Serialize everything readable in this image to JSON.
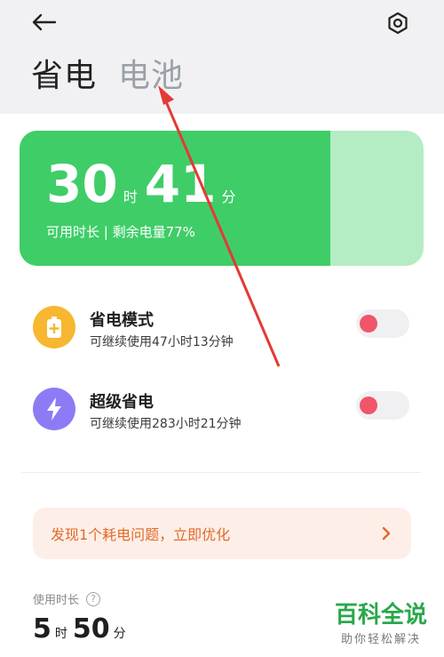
{
  "header": {
    "tabs": [
      {
        "label": "省电"
      },
      {
        "label": "电池"
      }
    ]
  },
  "battery": {
    "hours": "30",
    "hours_unit": "时",
    "minutes": "41",
    "minutes_unit": "分",
    "subtitle": "可用时长 | 剩余电量77%",
    "level_fraction": 0.77,
    "colors": {
      "fill": "#3fcd68",
      "remaining": "#b4ecc4"
    }
  },
  "modes": [
    {
      "title": "省电模式",
      "subtitle": "可继续使用47小时13分钟",
      "icon": "battery-plus-icon",
      "icon_color": "#f7b731",
      "enabled": false
    },
    {
      "title": "超级省电",
      "subtitle": "可继续使用283小时21分钟",
      "icon": "lightning-icon",
      "icon_color": "#8b7cf6",
      "enabled": false
    }
  ],
  "issue_banner": {
    "text": "发现1个耗电问题，立即优化"
  },
  "usage": {
    "label": "使用时长",
    "hours": "5",
    "hours_unit": "时",
    "minutes": "50",
    "minutes_unit": "分"
  },
  "watermark": {
    "title": "百科全说",
    "subtitle": "助你轻松解决"
  }
}
